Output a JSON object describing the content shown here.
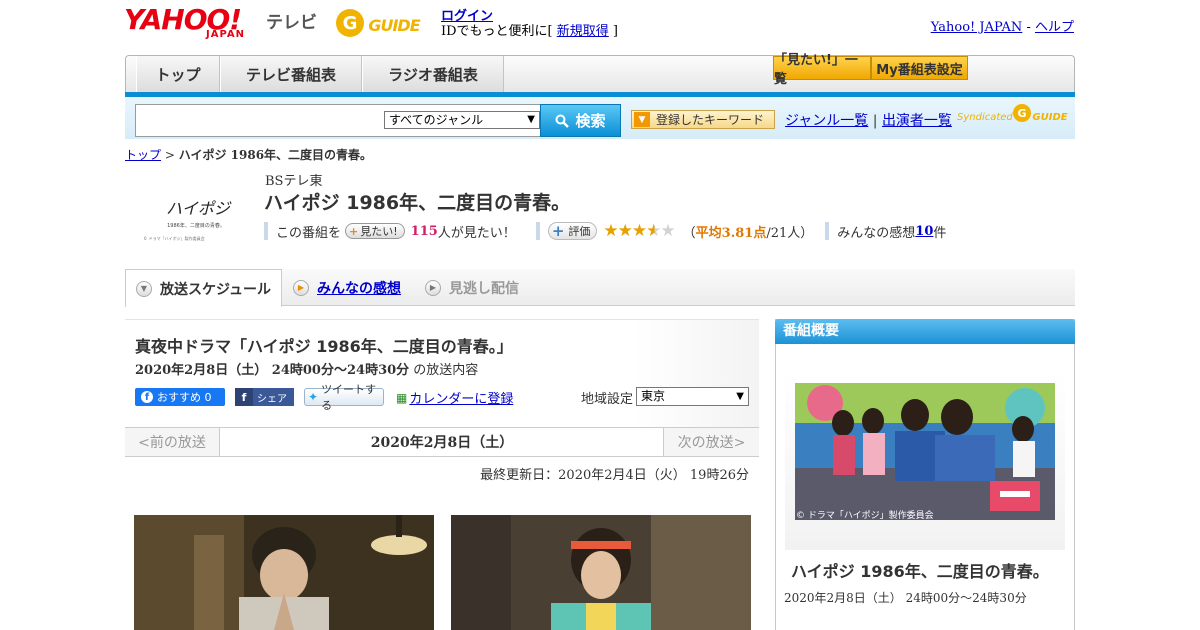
{
  "header": {
    "yahoo_logo": "YAHOO!",
    "yahoo_sub": "JAPAN",
    "tv_label": "テレビ",
    "gguide_logo": "G GUIDE",
    "login": "ログイン",
    "login_sub_prefix": "IDでもっと便利に[ ",
    "register": "新規取得",
    "login_sub_suffix": " ]",
    "yahoo_japan": "Yahoo! JAPAN",
    "separator": " - ",
    "help": "ヘルプ"
  },
  "nav": {
    "tabs": [
      "トップ",
      "テレビ番組表",
      "ラジオ番組表"
    ],
    "mitai_list": "「見たい!」一覧",
    "my_schedule": "My番組表設定"
  },
  "search": {
    "genre": "すべてのジャンル",
    "button": "検索",
    "keyword_button": "登録したキーワード",
    "genre_list": "ジャンル一覧",
    "divider": " | ",
    "performer_list": "出演者一覧",
    "syndicated": "Syndicated"
  },
  "breadcrumb": {
    "top": "トップ",
    "sep": " > ",
    "current": "ハイポジ 1986年、二度目の青春。"
  },
  "program": {
    "logo_text": "ハイポジ",
    "logo_sub": "1986年、二度目の青春。",
    "logo_credit": "© ドラマ「ハイポジ」製作委員会",
    "channel": "BSテレ東",
    "title": "ハイポジ 1986年、二度目の青春。",
    "watch_prefix": "この番組を",
    "mitai_btn": "見たい!",
    "mitai_count": "115",
    "mitai_suffix": "人が見たい！",
    "rating_btn": "評価",
    "rating_value": 3.81,
    "avg_open": "（",
    "avg_text": "平均3.81点",
    "avg_people": "/21人",
    "avg_close": "）",
    "review_prefix": "みんなの感想 ",
    "review_count": "10",
    "review_suffix": "件"
  },
  "subtabs": [
    "放送スケジュール",
    "みんなの感想",
    "見逃し配信"
  ],
  "schedule": {
    "title": "真夜中ドラマ「ハイポジ 1986年、二度目の青春。」",
    "date_time": "2020年2月8日（土） 24時00分～24時30分",
    "time_suffix": " の放送内容",
    "fb_label": "おすすめ 0",
    "share_label": "シェア",
    "tweet_label": "ツイートする",
    "calendar_label": "カレンダーに登録",
    "region_label": "地域設定",
    "region_value": "東京",
    "prev": "<前の放送",
    "current_date": "2020年2月8日（土）",
    "next": "次の放送>",
    "updated": "最終更新日：2020年2月4日（火） 19時26分"
  },
  "sidebar": {
    "header": "番組概要",
    "credit": "© ドラマ「ハイポジ」製作委員会",
    "title": "ハイポジ 1986年、二度目の青春。",
    "time": "2020年2月8日（土） 24時00分～24時30分"
  },
  "colors": {
    "accent_blue": "#0a8ed3",
    "yahoo_red": "#e60012",
    "gguide_yellow": "#f0b400",
    "star": "#e8a000"
  }
}
